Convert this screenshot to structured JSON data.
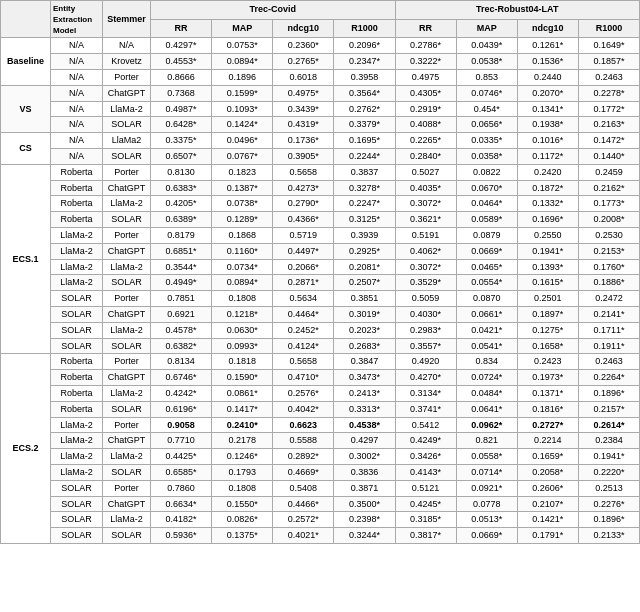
{
  "table": {
    "col_headers": {
      "entity_extraction": "Entity\nExtraction\nModel",
      "stemmer": "Stemmer",
      "trec_covid": "Trec-Covid",
      "trec_robust": "Trec-Robust04-LAT",
      "rr1": "RR",
      "map1": "MAP",
      "ndcg1": "ndcg10",
      "r1000_1": "R1000",
      "rr2": "RR",
      "map2": "MAP",
      "ndcg2": "ndcg10",
      "r1000_2": "R1000"
    },
    "groups": [
      {
        "name": "Baseline",
        "rows": [
          {
            "entity": "N/A",
            "stemmer": "N/A",
            "rr1": "0.4297*",
            "map1": "0.0753*",
            "ndcg1": "0.2360*",
            "r1000_1": "0.2096*",
            "rr2": "0.2786*",
            "map2": "0.0439*",
            "ndcg2": "0.1261*",
            "r1000_2": "0.1649*"
          },
          {
            "entity": "N/A",
            "stemmer": "Krovetz",
            "rr1": "0.4553*",
            "map1": "0.0894*",
            "ndcg1": "0.2765*",
            "r1000_1": "0.2347*",
            "rr2": "0.3222*",
            "map2": "0.0538*",
            "ndcg2": "0.1536*",
            "r1000_2": "0.1857*"
          },
          {
            "entity": "N/A",
            "stemmer": "Porter",
            "rr1": "0.8666",
            "map1": "0.1896",
            "ndcg1": "0.6018",
            "r1000_1": "0.3958",
            "rr2": "0.4975",
            "map2": "0.853",
            "ndcg2": "0.2440",
            "r1000_2": "0.2463"
          }
        ]
      },
      {
        "name": "VS",
        "rows": [
          {
            "entity": "N/A",
            "stemmer": "ChatGPT",
            "rr1": "0.7368",
            "map1": "0.1599*",
            "ndcg1": "0.4975*",
            "r1000_1": "0.3564*",
            "rr2": "0.4305*",
            "map2": "0.0746*",
            "ndcg2": "0.2070*",
            "r1000_2": "0.2278*"
          },
          {
            "entity": "N/A",
            "stemmer": "LlaMa-2",
            "rr1": "0.4987*",
            "map1": "0.1093*",
            "ndcg1": "0.3439*",
            "r1000_1": "0.2762*",
            "rr2": "0.2919*",
            "map2": "0.454*",
            "ndcg2": "0.1341*",
            "r1000_2": "0.1772*"
          },
          {
            "entity": "N/A",
            "stemmer": "SOLAR",
            "rr1": "0.6428*",
            "map1": "0.1424*",
            "ndcg1": "0.4319*",
            "r1000_1": "0.3379*",
            "rr2": "0.4088*",
            "map2": "0.0656*",
            "ndcg2": "0.1938*",
            "r1000_2": "0.2163*"
          }
        ]
      },
      {
        "name": "CS",
        "rows": [
          {
            "entity": "N/A",
            "stemmer": "LlaMa2",
            "rr1": "0.3375*",
            "map1": "0.0496*",
            "ndcg1": "0.1736*",
            "r1000_1": "0.1695*",
            "rr2": "0.2265*",
            "map2": "0.0335*",
            "ndcg2": "0.1016*",
            "r1000_2": "0.1472*"
          },
          {
            "entity": "N/A",
            "stemmer": "SOLAR",
            "rr1": "0.6507*",
            "map1": "0.0767*",
            "ndcg1": "0.3905*",
            "r1000_1": "0.2244*",
            "rr2": "0.2840*",
            "map2": "0.0358*",
            "ndcg2": "0.1172*",
            "r1000_2": "0.1440*"
          }
        ]
      },
      {
        "name": "ECS.1-Roberta",
        "display": "ECS.1",
        "rows": [
          {
            "entity": "Roberta",
            "stemmer": "Porter",
            "rr1": "0.8130",
            "map1": "0.1823",
            "ndcg1": "0.5658",
            "r1000_1": "0.3837",
            "rr2": "0.5027",
            "map2": "0.0822",
            "ndcg2": "0.2420",
            "r1000_2": "0.2459"
          },
          {
            "entity": "Roberta",
            "stemmer": "ChatGPT",
            "rr1": "0.6383*",
            "map1": "0.1387*",
            "ndcg1": "0.4273*",
            "r1000_1": "0.3278*",
            "rr2": "0.4035*",
            "map2": "0.0670*",
            "ndcg2": "0.1872*",
            "r1000_2": "0.2162*"
          },
          {
            "entity": "Roberta",
            "stemmer": "LlaMa-2",
            "rr1": "0.4205*",
            "map1": "0.0738*",
            "ndcg1": "0.2790*",
            "r1000_1": "0.2247*",
            "rr2": "0.3072*",
            "map2": "0.0464*",
            "ndcg2": "0.1332*",
            "r1000_2": "0.1773*"
          },
          {
            "entity": "Roberta",
            "stemmer": "SOLAR",
            "rr1": "0.6389*",
            "map1": "0.1289*",
            "ndcg1": "0.4366*",
            "r1000_1": "0.3125*",
            "rr2": "0.3621*",
            "map2": "0.0589*",
            "ndcg2": "0.1696*",
            "r1000_2": "0.2008*"
          }
        ]
      },
      {
        "name": "ECS.1-LlaMa2",
        "display": "",
        "rows": [
          {
            "entity": "LlaMa-2",
            "stemmer": "Porter",
            "rr1": "0.8179",
            "map1": "0.1868",
            "ndcg1": "0.5719",
            "r1000_1": "0.3939",
            "rr2": "0.5191",
            "map2": "0.0879",
            "ndcg2": "0.2550",
            "r1000_2": "0.2530"
          },
          {
            "entity": "LlaMa-2",
            "stemmer": "ChatGPT",
            "rr1": "0.6851*",
            "map1": "0.1160*",
            "ndcg1": "0.4497*",
            "r1000_1": "0.2925*",
            "rr2": "0.4062*",
            "map2": "0.0669*",
            "ndcg2": "0.1941*",
            "r1000_2": "0.2153*"
          },
          {
            "entity": "LlaMa-2",
            "stemmer": "LlaMa-2",
            "rr1": "0.3544*",
            "map1": "0.0734*",
            "ndcg1": "0.2066*",
            "r1000_1": "0.2081*",
            "rr2": "0.3072*",
            "map2": "0.0465*",
            "ndcg2": "0.1393*",
            "r1000_2": "0.1760*"
          },
          {
            "entity": "LlaMa-2",
            "stemmer": "SOLAR",
            "rr1": "0.4949*",
            "map1": "0.0894*",
            "ndcg1": "0.2871*",
            "r1000_1": "0.2507*",
            "rr2": "0.3529*",
            "map2": "0.0554*",
            "ndcg2": "0.1615*",
            "r1000_2": "0.1886*"
          }
        ]
      },
      {
        "name": "ECS.1-SOLAR",
        "display": "",
        "rows": [
          {
            "entity": "SOLAR",
            "stemmer": "Porter",
            "rr1": "0.7851",
            "map1": "0.1808",
            "ndcg1": "0.5634",
            "r1000_1": "0.3851",
            "rr2": "0.5059",
            "map2": "0.0870",
            "ndcg2": "0.2501",
            "r1000_2": "0.2472"
          },
          {
            "entity": "SOLAR",
            "stemmer": "ChatGPT",
            "rr1": "0.6921",
            "map1": "0.1218*",
            "ndcg1": "0.4464*",
            "r1000_1": "0.3019*",
            "rr2": "0.4030*",
            "map2": "0.0661*",
            "ndcg2": "0.1897*",
            "r1000_2": "0.2141*"
          },
          {
            "entity": "SOLAR",
            "stemmer": "LlaMa-2",
            "rr1": "0.4578*",
            "map1": "0.0630*",
            "ndcg1": "0.2452*",
            "r1000_1": "0.2023*",
            "rr2": "0.2983*",
            "map2": "0.0421*",
            "ndcg2": "0.1275*",
            "r1000_2": "0.1711*"
          },
          {
            "entity": "SOLAR",
            "stemmer": "SOLAR",
            "rr1": "0.6382*",
            "map1": "0.0993*",
            "ndcg1": "0.4124*",
            "r1000_1": "0.2683*",
            "rr2": "0.3557*",
            "map2": "0.0541*",
            "ndcg2": "0.1658*",
            "r1000_2": "0.1911*"
          }
        ]
      },
      {
        "name": "ECS.2-Roberta",
        "display": "ECS.2",
        "rows": [
          {
            "entity": "Roberta",
            "stemmer": "Porter",
            "rr1": "0.8134",
            "map1": "0.1818",
            "ndcg1": "0.5658",
            "r1000_1": "0.3847",
            "rr2": "0.4920",
            "map2": "0.834",
            "ndcg2": "0.2423",
            "r1000_2": "0.2463"
          },
          {
            "entity": "Roberta",
            "stemmer": "ChatGPT",
            "rr1": "0.6746*",
            "map1": "0.1590*",
            "ndcg1": "0.4710*",
            "r1000_1": "0.3473*",
            "rr2": "0.4270*",
            "map2": "0.0724*",
            "ndcg2": "0.1973*",
            "r1000_2": "0.2264*"
          },
          {
            "entity": "Roberta",
            "stemmer": "LlaMa-2",
            "rr1": "0.4242*",
            "map1": "0.0861*",
            "ndcg1": "0.2576*",
            "r1000_1": "0.2413*",
            "rr2": "0.3134*",
            "map2": "0.0484*",
            "ndcg2": "0.1371*",
            "r1000_2": "0.1896*"
          },
          {
            "entity": "Roberta",
            "stemmer": "SOLAR",
            "rr1": "0.6196*",
            "map1": "0.1417*",
            "ndcg1": "0.4042*",
            "r1000_1": "0.3313*",
            "rr2": "0.3741*",
            "map2": "0.0641*",
            "ndcg2": "0.1816*",
            "r1000_2": "0.2157*"
          }
        ]
      },
      {
        "name": "ECS.2-LlaMa2",
        "display": "",
        "rows": [
          {
            "entity": "LlaMa-2",
            "stemmer": "Porter",
            "rr1": "0.9058",
            "map1": "0.2410*",
            "ndcg1": "0.6623",
            "r1000_1": "0.4538*",
            "rr2": "0.5412",
            "map2": "0.0962*",
            "ndcg2": "0.2727*",
            "r1000_2": "0.2614*",
            "bold_cols": [
              "rr1",
              "map1",
              "ndcg1",
              "r1000_1",
              "map2",
              "ndcg2",
              "r1000_2"
            ]
          },
          {
            "entity": "LlaMa-2",
            "stemmer": "ChatGPT",
            "rr1": "0.7710",
            "map1": "0.2178",
            "ndcg1": "0.5588",
            "r1000_1": "0.4297",
            "rr2": "0.4249*",
            "map2": "0.821",
            "ndcg2": "0.2214",
            "r1000_2": "0.2384"
          },
          {
            "entity": "LlaMa-2",
            "stemmer": "LlaMa-2",
            "rr1": "0.4425*",
            "map1": "0.1246*",
            "ndcg1": "0.2892*",
            "r1000_1": "0.3002*",
            "rr2": "0.3426*",
            "map2": "0.0558*",
            "ndcg2": "0.1659*",
            "r1000_2": "0.1941*"
          },
          {
            "entity": "LlaMa-2",
            "stemmer": "SOLAR",
            "rr1": "0.6585*",
            "map1": "0.1793",
            "ndcg1": "0.4669*",
            "r1000_1": "0.3836",
            "rr2": "0.4143*",
            "map2": "0.0714*",
            "ndcg2": "0.2058*",
            "r1000_2": "0.2220*"
          }
        ]
      },
      {
        "name": "ECS.2-SOLAR",
        "display": "",
        "rows": [
          {
            "entity": "SOLAR",
            "stemmer": "Porter",
            "rr1": "0.7860",
            "map1": "0.1808",
            "ndcg1": "0.5408",
            "r1000_1": "0.3871",
            "rr2": "0.5121",
            "map2": "0.0921*",
            "ndcg2": "0.2606*",
            "r1000_2": "0.2513"
          },
          {
            "entity": "SOLAR",
            "stemmer": "ChatGPT",
            "rr1": "0.6634*",
            "map1": "0.1550*",
            "ndcg1": "0.4466*",
            "r1000_1": "0.3500*",
            "rr2": "0.4245*",
            "map2": "0.0778",
            "ndcg2": "0.2107*",
            "r1000_2": "0.2276*"
          },
          {
            "entity": "SOLAR",
            "stemmer": "LlaMa-2",
            "rr1": "0.4182*",
            "map1": "0.0826*",
            "ndcg1": "0.2572*",
            "r1000_1": "0.2398*",
            "rr2": "0.3185*",
            "map2": "0.0513*",
            "ndcg2": "0.1421*",
            "r1000_2": "0.1896*"
          },
          {
            "entity": "SOLAR",
            "stemmer": "SOLAR",
            "rr1": "0.5936*",
            "map1": "0.1375*",
            "ndcg1": "0.4021*",
            "r1000_1": "0.3244*",
            "rr2": "0.3817*",
            "map2": "0.0669*",
            "ndcg2": "0.1791*",
            "r1000_2": "0.2133*"
          }
        ]
      }
    ]
  }
}
